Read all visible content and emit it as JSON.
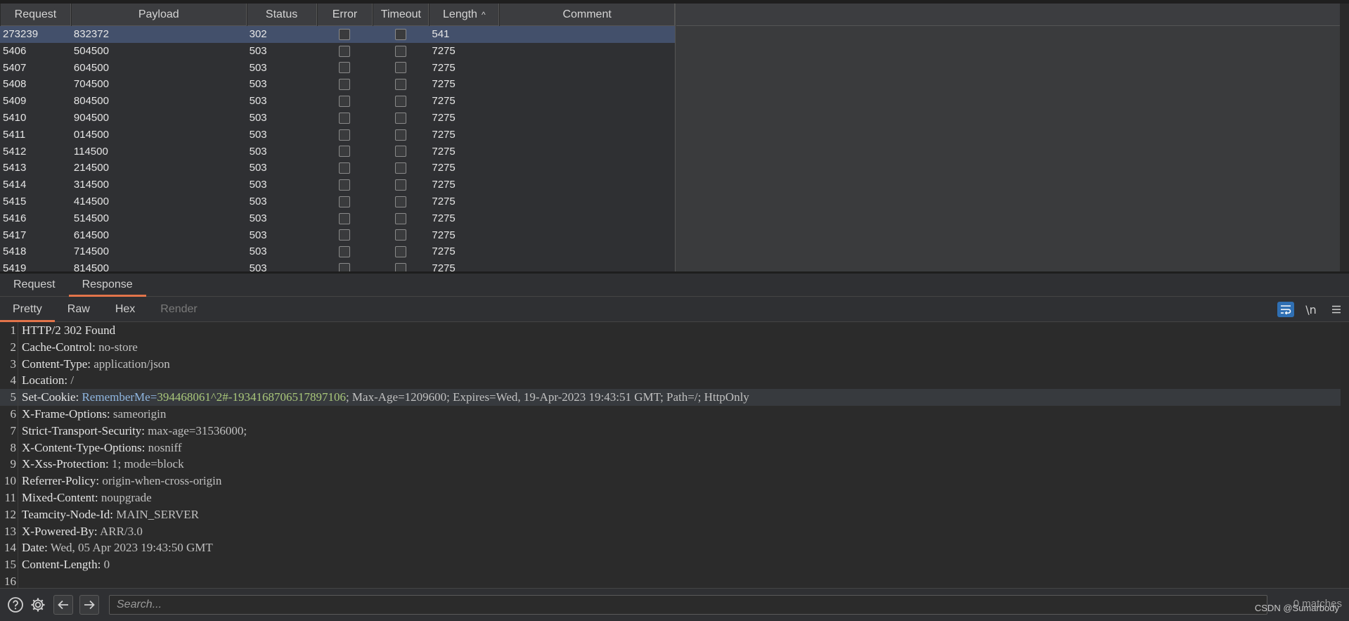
{
  "results": {
    "columns": [
      "Request",
      "Payload",
      "Status",
      "Error",
      "Timeout",
      "Length",
      "Comment"
    ],
    "sort_indicator": "^",
    "rows": [
      {
        "request": "273239",
        "payload": "832372",
        "status": "302",
        "error": false,
        "timeout": false,
        "length": "541",
        "comment": "",
        "selected": true
      },
      {
        "request": "5406",
        "payload": "504500",
        "status": "503",
        "error": false,
        "timeout": false,
        "length": "7275",
        "comment": ""
      },
      {
        "request": "5407",
        "payload": "604500",
        "status": "503",
        "error": false,
        "timeout": false,
        "length": "7275",
        "comment": ""
      },
      {
        "request": "5408",
        "payload": "704500",
        "status": "503",
        "error": false,
        "timeout": false,
        "length": "7275",
        "comment": ""
      },
      {
        "request": "5409",
        "payload": "804500",
        "status": "503",
        "error": false,
        "timeout": false,
        "length": "7275",
        "comment": ""
      },
      {
        "request": "5410",
        "payload": "904500",
        "status": "503",
        "error": false,
        "timeout": false,
        "length": "7275",
        "comment": ""
      },
      {
        "request": "5411",
        "payload": "014500",
        "status": "503",
        "error": false,
        "timeout": false,
        "length": "7275",
        "comment": ""
      },
      {
        "request": "5412",
        "payload": "114500",
        "status": "503",
        "error": false,
        "timeout": false,
        "length": "7275",
        "comment": ""
      },
      {
        "request": "5413",
        "payload": "214500",
        "status": "503",
        "error": false,
        "timeout": false,
        "length": "7275",
        "comment": ""
      },
      {
        "request": "5414",
        "payload": "314500",
        "status": "503",
        "error": false,
        "timeout": false,
        "length": "7275",
        "comment": ""
      },
      {
        "request": "5415",
        "payload": "414500",
        "status": "503",
        "error": false,
        "timeout": false,
        "length": "7275",
        "comment": ""
      },
      {
        "request": "5416",
        "payload": "514500",
        "status": "503",
        "error": false,
        "timeout": false,
        "length": "7275",
        "comment": ""
      },
      {
        "request": "5417",
        "payload": "614500",
        "status": "503",
        "error": false,
        "timeout": false,
        "length": "7275",
        "comment": ""
      },
      {
        "request": "5418",
        "payload": "714500",
        "status": "503",
        "error": false,
        "timeout": false,
        "length": "7275",
        "comment": ""
      },
      {
        "request": "5419",
        "payload": "814500",
        "status": "503",
        "error": false,
        "timeout": false,
        "length": "7275",
        "comment": ""
      }
    ]
  },
  "message_tabs": [
    {
      "label": "Request",
      "active": false
    },
    {
      "label": "Response",
      "active": true
    }
  ],
  "view_tabs": [
    {
      "label": "Pretty",
      "active": true,
      "disabled": false
    },
    {
      "label": "Raw",
      "active": false,
      "disabled": false
    },
    {
      "label": "Hex",
      "active": false,
      "disabled": false
    },
    {
      "label": "Render",
      "active": false,
      "disabled": true
    }
  ],
  "view_tools": {
    "wrap_icon": "wrap-lines-icon",
    "newline_label": "\\n",
    "menu_icon": "hamburger-menu-icon"
  },
  "response_lines": [
    {
      "n": "1",
      "key": "HTTP/2 302 Found",
      "val": ""
    },
    {
      "n": "2",
      "key": "Cache-Control:",
      "val": " no-store"
    },
    {
      "n": "3",
      "key": "Content-Type:",
      "val": " application/json"
    },
    {
      "n": "4",
      "key": "Location:",
      "val": " /"
    },
    {
      "n": "5",
      "key": "Set-Cookie:",
      "cookie_name": " RememberMe=",
      "cookie_value": "394468061^2#-1934168706517897106",
      "val": "; Max-Age=1209600; Expires=Wed, 19-Apr-2023 19:43:51 GMT; Path=/; HttpOnly",
      "highlight": true
    },
    {
      "n": "6",
      "key": "X-Frame-Options:",
      "val": " sameorigin"
    },
    {
      "n": "7",
      "key": "Strict-Transport-Security:",
      "val": " max-age=31536000;"
    },
    {
      "n": "8",
      "key": "X-Content-Type-Options:",
      "val": " nosniff"
    },
    {
      "n": "9",
      "key": "X-Xss-Protection:",
      "val": " 1; mode=block"
    },
    {
      "n": "10",
      "key": "Referrer-Policy:",
      "val": " origin-when-cross-origin"
    },
    {
      "n": "11",
      "key": "Mixed-Content:",
      "val": " noupgrade"
    },
    {
      "n": "12",
      "key": "Teamcity-Node-Id:",
      "val": " MAIN_SERVER"
    },
    {
      "n": "13",
      "key": "X-Powered-By:",
      "val": " ARR/3.0"
    },
    {
      "n": "14",
      "key": "Date:",
      "val": " Wed, 05 Apr 2023 19:43:50 GMT"
    },
    {
      "n": "15",
      "key": "Content-Length:",
      "val": " 0"
    },
    {
      "n": "16",
      "key": "",
      "val": ""
    }
  ],
  "search": {
    "placeholder": "Search...",
    "matches": "0 matches"
  },
  "watermark": "CSDN @Sumarbody",
  "colors": {
    "accent": "#e2744a",
    "selected_row": "#43506b",
    "wrap_button": "#2f6fb3",
    "cookie_name": "#8fb6e0",
    "cookie_value": "#a9c77a"
  }
}
